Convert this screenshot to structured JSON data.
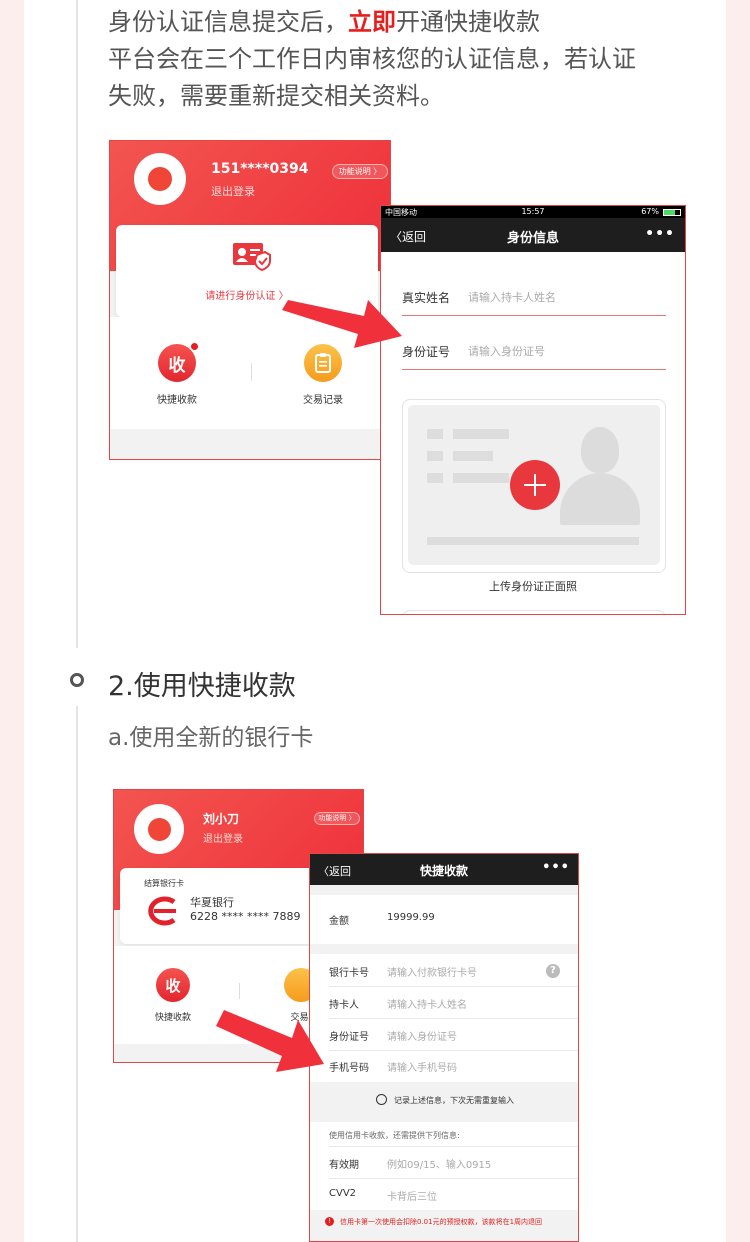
{
  "intro": {
    "line1_before": "身份认证信息提交后，",
    "line1_highlight": "立即",
    "line1_after": "开通快捷收款",
    "line2": "平台会在三个工作日内审核您的认证信息，若认证",
    "line3": "失败，需要重新提交相关资料。"
  },
  "step2": {
    "title": "2.使用快捷收款",
    "subtitle": "a.使用全新的银行卡"
  },
  "shot1": {
    "phone": "151****0394",
    "logout": "退出登录",
    "func_btn": "功能说明 〉",
    "verify_link": "请进行身份认证 〉",
    "quick_icon": "收",
    "quick_label": "快捷收款",
    "records_label": "交易记录"
  },
  "shot2": {
    "status_carrier": "中国移动",
    "status_time": "15:57",
    "status_battery": "67%",
    "back_label": "返回",
    "title": "身份信息",
    "more": "•••",
    "name_label": "真实姓名",
    "name_placeholder": "请输入持卡人姓名",
    "id_label": "身份证号",
    "id_placeholder": "请输入身份证号",
    "upload_label": "上传身份证正面照"
  },
  "shot3": {
    "name": "刘小刀",
    "logout": "退出登录",
    "func_btn": "功能说明 〉",
    "card_header": "结算银行卡",
    "bank_name": "华夏银行",
    "card_number": "6228 **** **** 7889",
    "quick_icon": "收",
    "quick_label": "快捷收款",
    "records_label": "交易记"
  },
  "shot4": {
    "back_label": "返回",
    "title": "快捷收款",
    "more": "•••",
    "amount_label": "金额",
    "amount_value": "19999.99",
    "card_label": "银行卡号",
    "card_placeholder": "请输入付款银行卡号",
    "holder_label": "持卡人",
    "holder_placeholder": "请输入持卡人姓名",
    "id_label": "身份证号",
    "id_placeholder": "请输入身份证号",
    "mobile_label": "手机号码",
    "mobile_placeholder": "请输入手机号码",
    "remember_label": "记录上述信息，下次无需重复输入",
    "credit_note": "使用信用卡收款，还需提供下列信息:",
    "expiry_label": "有效期",
    "expiry_placeholder": "例如09/15、输入0915",
    "cvv_label": "CVV2",
    "cvv_placeholder": "卡背后三位",
    "warning": "信用卡第一次使用会扣除0.01元的预授权款，该款将在1周内退回"
  },
  "colors": {
    "accent_red": "#e61e1e",
    "nav_dark": "#1e1e1e",
    "orange": "#f5a623"
  }
}
